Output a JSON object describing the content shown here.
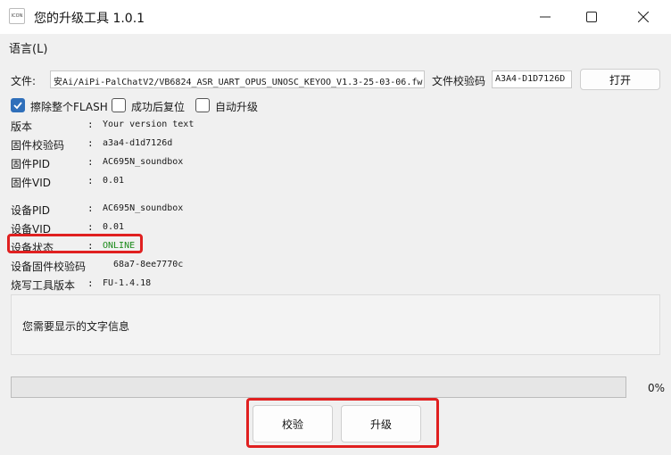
{
  "window": {
    "icon_text": "ICON",
    "title": "您的升级工具 1.0.1"
  },
  "menu": {
    "language": "语言(L)"
  },
  "file": {
    "label": "文件:",
    "path": "安Ai/AiPi-PalChatV2/VB6824_ASR_UART_OPUS_UNOSC_KEYOO_V1.3-25-03-06.fw",
    "checksum_label": "文件校验码",
    "checksum": "A3A4-D1D7126D",
    "open_button": "打开"
  },
  "options": {
    "erase_flash": {
      "label": "擦除整个FLASH",
      "checked": true
    },
    "reset_after_success": {
      "label": "成功后复位",
      "checked": false
    },
    "auto_upgrade": {
      "label": "自动升级",
      "checked": false
    }
  },
  "firmware_info": [
    {
      "key": "版本",
      "sep": ":",
      "value": "Your version text"
    },
    {
      "key": "固件校验码",
      "sep": ":",
      "value": "a3a4-d1d7126d"
    },
    {
      "key": "固件PID",
      "sep": ":",
      "value": "AC695N_soundbox"
    },
    {
      "key": "固件VID",
      "sep": ":",
      "value": "0.01"
    }
  ],
  "device_info": [
    {
      "key": "设备PID",
      "sep": ":",
      "value": "AC695N_soundbox"
    },
    {
      "key": "设备VID",
      "sep": ":",
      "value": "0.01"
    },
    {
      "key": "设备状态",
      "sep": ":",
      "value": "ONLINE"
    },
    {
      "key": "设备固件校验码",
      "sep": ":",
      "value": "68a7-8ee7770c"
    },
    {
      "key": "烧写工具版本",
      "sep": ":",
      "value": "FU-1.4.18"
    }
  ],
  "message": "您需要显示的文字信息",
  "progress": {
    "percent_text": "0%",
    "value": 0
  },
  "actions": {
    "verify": "校验",
    "upgrade": "升级"
  },
  "colors": {
    "online_status": "#1a8a1a",
    "highlight_box": "#e02020",
    "checkbox_checked": "#2f6fba"
  }
}
